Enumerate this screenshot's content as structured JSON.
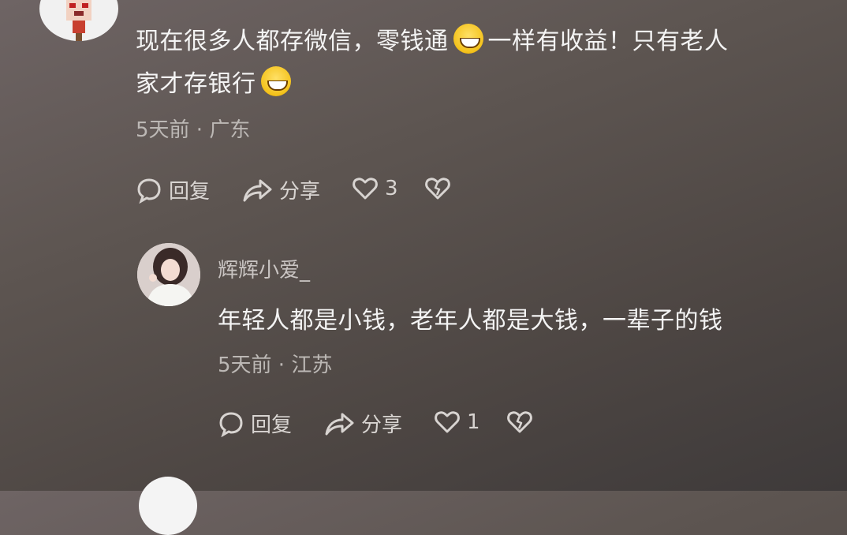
{
  "comment1": {
    "line1_a": "现在很多人都存微信，零钱通",
    "line1_b": "一样有收益！只有老人",
    "line2": "家才存银行",
    "meta": "5天前 · 广东",
    "reply_label": "回复",
    "share_label": "分享",
    "like_count": "3"
  },
  "reply1": {
    "username": "辉辉小爱_",
    "text": "年轻人都是小钱，老年人都是大钱，一辈子的钱",
    "meta": "5天前 · 江苏",
    "reply_label": "回复",
    "share_label": "分享",
    "like_count": "1"
  },
  "icons": [
    "comment-bubble-icon",
    "share-arrow-icon",
    "heart-icon",
    "broken-heart-icon",
    "grin-emoji-icon"
  ]
}
